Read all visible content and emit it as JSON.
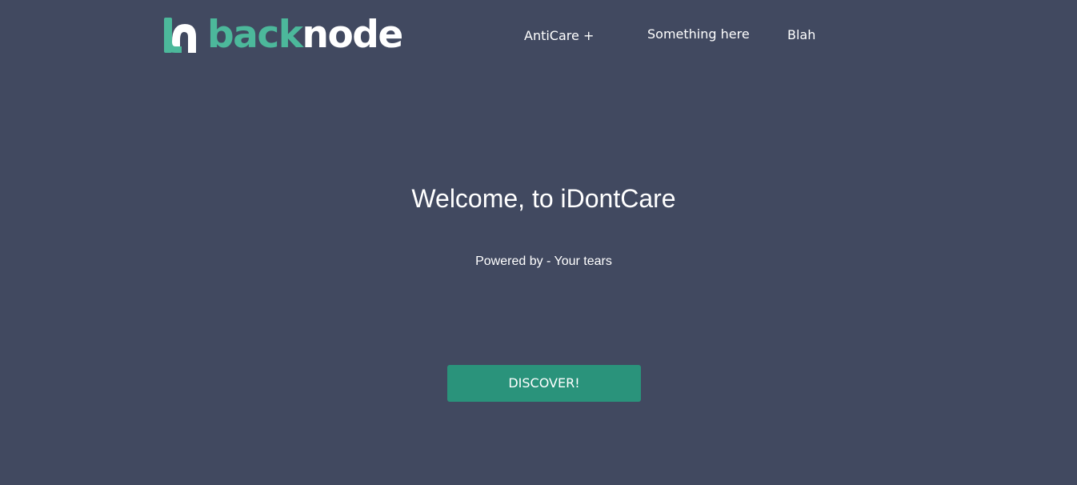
{
  "header": {
    "logo": {
      "text_part_a": "back",
      "text_part_b": "node",
      "icon": "backnode-logo-icon",
      "color_a": "#4cb89b",
      "color_b": "#ffffff"
    },
    "nav": [
      {
        "label": "AntiCare +"
      },
      {
        "label": "Something here"
      },
      {
        "label": "Blah"
      }
    ]
  },
  "hero": {
    "title": "Welcome, to iDontCare",
    "subtitle": "Powered by - Your tears",
    "cta_label": "DISCOVER!"
  },
  "colors": {
    "background": "#414960",
    "accent": "#2a937b"
  }
}
